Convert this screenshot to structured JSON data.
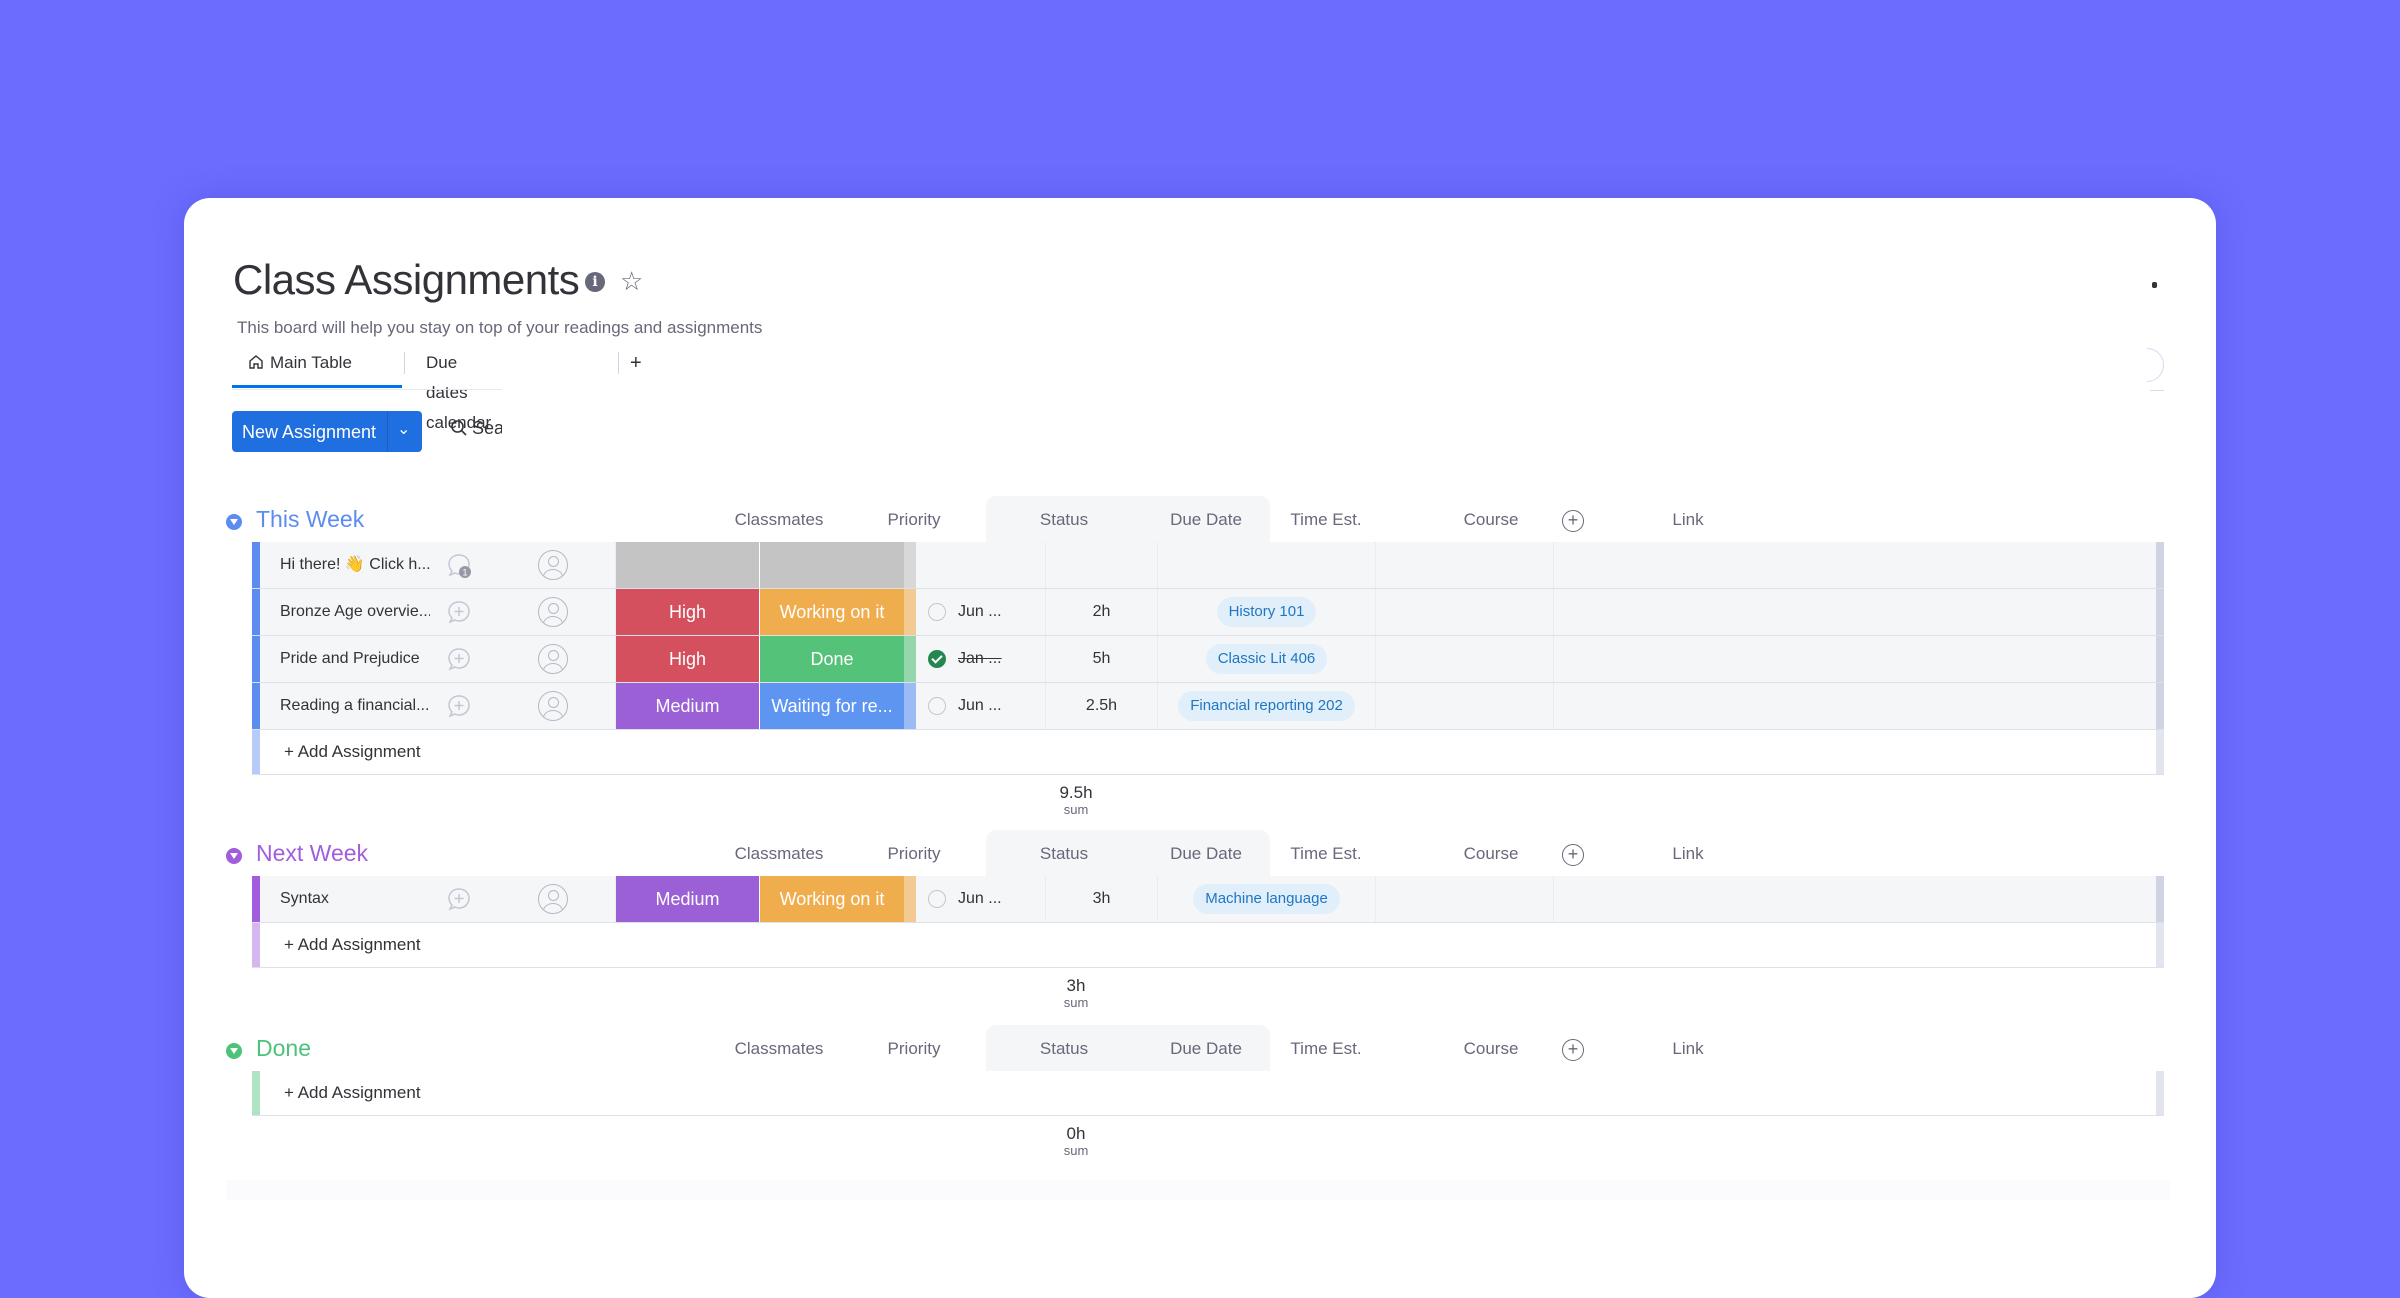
{
  "board": {
    "title": "Class Assignments",
    "description": "This board will help you stay on top of your readings and assignments",
    "icons": {
      "info": "info-icon",
      "favorite": "star-icon"
    }
  },
  "views": {
    "tabs": [
      {
        "label": "Main Table",
        "icon": "home-icon",
        "active": true
      },
      {
        "label": "Due dates calendar",
        "active": false
      }
    ],
    "add_label": "+"
  },
  "toolbar": {
    "new_item_label": "New Assignment",
    "search_label": "Search"
  },
  "columns": [
    "Classmates",
    "Priority",
    "Status",
    "Due Date",
    "Time Est.",
    "Course",
    "Link"
  ],
  "add_item_label": "+ Add Assignment",
  "sum_label": "sum",
  "colors": {
    "high": "#d4505f",
    "medium": "#9b5fd6",
    "working": "#f0ad4e",
    "done": "#55c27a",
    "waiting": "#5e95f1",
    "empty": "#c4c4c4",
    "this_week": "#5c8cf0",
    "next_week": "#a25ddc",
    "done_group": "#4ec27a"
  },
  "groups": [
    {
      "name": "This Week",
      "color": "#5c8cf0",
      "sum": "9.5h",
      "items": [
        {
          "name": "Hi there! 👋 Click h...",
          "updates": "1",
          "priority": "",
          "status": "",
          "due": "",
          "due_done": false,
          "time": "",
          "course": ""
        },
        {
          "name": "Bronze Age overvie...",
          "priority": "High",
          "status": "Working on it",
          "due": "Jun ...",
          "due_done": false,
          "time": "2h",
          "course": "History 101"
        },
        {
          "name": "Pride and Prejudice",
          "priority": "High",
          "status": "Done",
          "due": "Jan ...",
          "due_done": true,
          "time": "5h",
          "course": "Classic Lit 406"
        },
        {
          "name": "Reading a financial...",
          "priority": "Medium",
          "status": "Waiting for re...",
          "due": "Jun ...",
          "due_done": false,
          "time": "2.5h",
          "course": "Financial reporting 202"
        }
      ]
    },
    {
      "name": "Next Week",
      "color": "#a25ddc",
      "sum": "3h",
      "items": [
        {
          "name": "Syntax",
          "priority": "Medium",
          "status": "Working on it",
          "due": "Jun ...",
          "due_done": false,
          "time": "3h",
          "course": "Machine language"
        }
      ]
    },
    {
      "name": "Done",
      "color": "#4ec27a",
      "sum": "0h",
      "items": []
    }
  ]
}
